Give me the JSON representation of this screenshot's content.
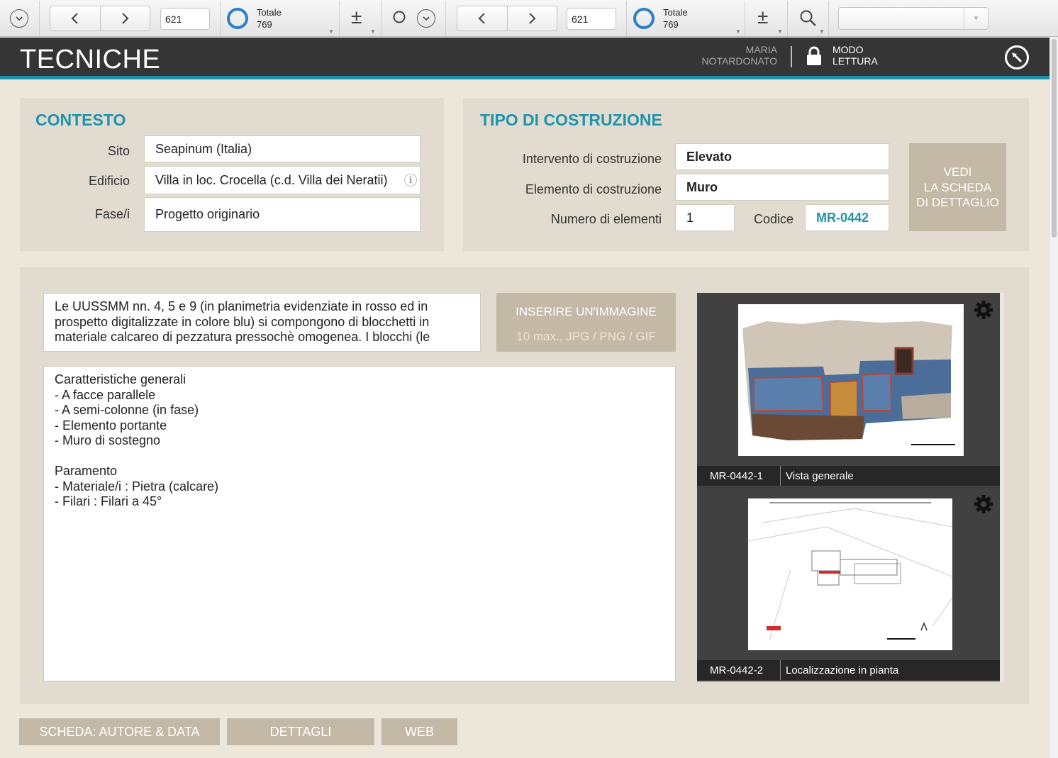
{
  "toolbar": {
    "left": {
      "record_number": "621",
      "total_label": "Totale",
      "total_value": "769"
    },
    "right": {
      "record_number": "621",
      "total_label": "Totale",
      "total_value": "769"
    },
    "icons": [
      "menu-circle-icon",
      "prev-record-icon",
      "next-record-icon",
      "plus-minus-icon",
      "search-icon",
      "dropdown-arrow-icon"
    ],
    "dropdown_value": ""
  },
  "header": {
    "title": "TECNICHE",
    "user_first": "MARIA",
    "user_last": "NOTARDONATO",
    "mode_line1": "MODO",
    "mode_line2": "LETTURA",
    "bg_color": "#353535",
    "accent_color": "#1d8fa8"
  },
  "contesto": {
    "title": "CONTESTO",
    "sito_label": "Sito",
    "sito_value": "Seapinum (Italia)",
    "edificio_label": "Edificio",
    "edificio_value": "Villa in loc. Crocella (c.d. Villa dei Neratii)",
    "fase_label": "Fase/i",
    "fase_value": "Progetto originario"
  },
  "tipo": {
    "title": "TIPO DI COSTRUZIONE",
    "intervento_label": "Intervento di costruzione",
    "intervento_value": "Elevato",
    "elemento_label": "Elemento di costruzione",
    "elemento_value": "Muro",
    "numero_label": "Numero di elementi",
    "numero_value": "1",
    "codice_label": "Codice",
    "codice_value": "MR-0442",
    "detail_button_line1": "VEDI",
    "detail_button_line2": "LA SCHEDA",
    "detail_button_line3": "DI DETTAGLIO"
  },
  "descrizione": {
    "lines": [
      "Le UUSSMM nn. 4, 5 e 9 (in planimetria evidenziate in rosso ed in",
      "prospetto digitalizzate in colore blu) si compongono di blocchetti in",
      "materiale calcareo di pezzatura pressochè omogenea. I blocchi (le"
    ]
  },
  "insert_image": {
    "label": "INSERIRE UN'IMMAGINE",
    "hint": "10 max., JPG / PNG / GIF"
  },
  "caratteristiche": {
    "lines": [
      "Caratteristiche generali",
      "- A facce parallele",
      "- A semi-colonne (in fase)",
      "- Elemento portante",
      "- Muro di sostegno",
      "",
      "Paramento",
      "- Materiale/i : Pietra (calcare)",
      "- Filari : Filari a 45°"
    ]
  },
  "images": [
    {
      "code": "MR-0442-1",
      "caption": "Vista generale"
    },
    {
      "code": "MR-0442-2",
      "caption": "Localizzazione in pianta"
    }
  ],
  "bottom_buttons": {
    "autore": "SCHEDA: AUTORE & DATA",
    "dettagli": "DETTAGLI",
    "web": "WEB"
  }
}
